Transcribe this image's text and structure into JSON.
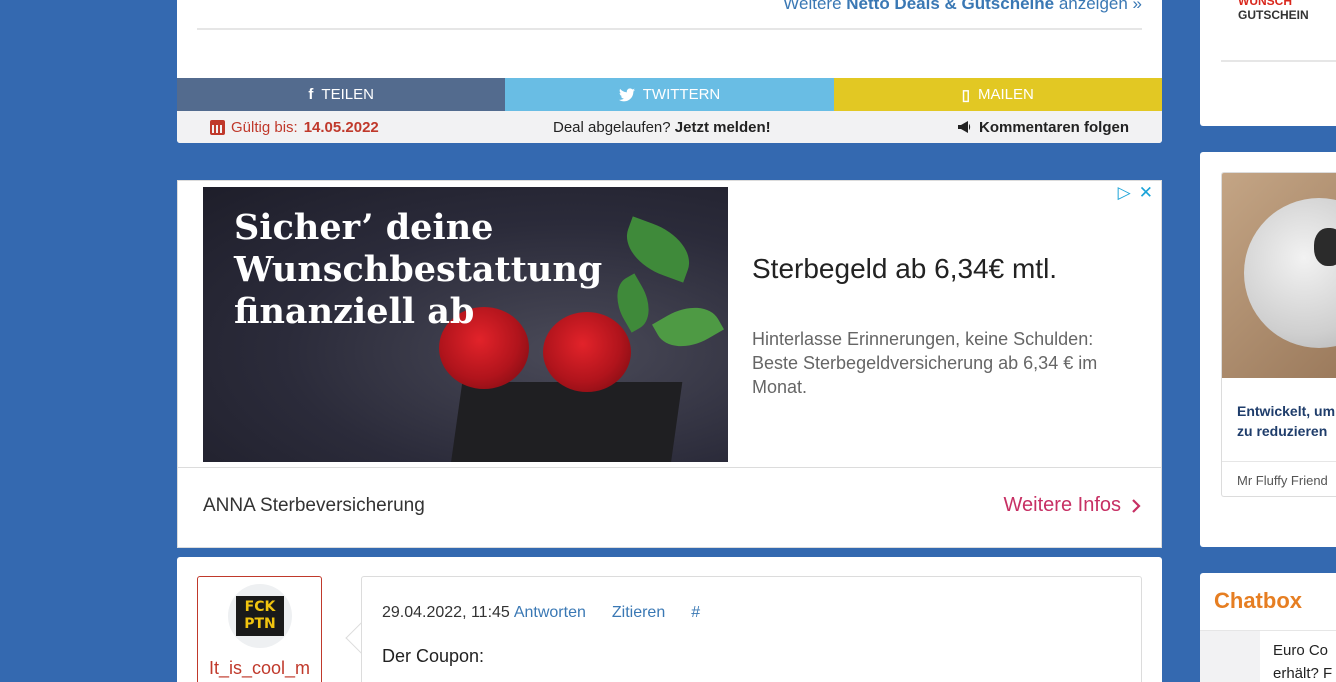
{
  "deal": {
    "more_deals_prefix": "Weitere ",
    "more_deals_bold": "Netto Deals & Gutscheine",
    "more_deals_suffix": " anzeigen »"
  },
  "share": {
    "facebook_label": "TEILEN",
    "twitter_label": "TWITTERN",
    "mail_label": "MAILEN",
    "facebook_icon": "f",
    "mail_icon": "▯"
  },
  "info": {
    "valid_label": "Gültig bis:",
    "valid_date": "14.05.2022",
    "expired_question": "Deal abgelaufen?",
    "expired_link": "Jetzt melden!",
    "follow_label": "Kommentaren folgen"
  },
  "ad": {
    "image_text_line1": "Sicher’ deine",
    "image_text_line2": "Wunschbestattung",
    "image_text_line3": "finanziell ab",
    "headline": "Sterbegeld ab 6,34€ mtl.",
    "description": "Hinterlasse Erinnerungen, keine Schulden: Beste Sterbegeldversicherung ab 6,34 € im Monat.",
    "brand": "ANNA Sterbeversicherung",
    "cta": "Weitere Infos",
    "choices_icon": "▷",
    "close_icon": "✕"
  },
  "comment": {
    "avatar_line1": "FCK",
    "avatar_line2": "PTN",
    "username": "It_is_cool_m",
    "timestamp": "29.04.2022, 11:45",
    "reply": "Antworten",
    "quote": "Zitieren",
    "permalink": "#",
    "text": "Der Coupon:"
  },
  "sidebar": {
    "logo_top": "WUNSCH",
    "logo_bottom": "GUTSCHEIN",
    "promo_title_line1": "Entwickelt, um",
    "promo_title_line2": "zu reduzieren",
    "promo_source": "Mr Fluffy Friend",
    "chatbox_title": "Chatbox",
    "chat_line1": "Euro Co",
    "chat_line2": "erhält? F"
  },
  "colors": {
    "page_bg": "#3469b0",
    "facebook": "#536b8e",
    "twitter": "#69bde4",
    "mail": "#e2c823",
    "alert_red": "#c0392b",
    "link_blue": "#3a78b4",
    "cta_pink": "#c73064",
    "chatbox_orange": "#e67e22"
  }
}
